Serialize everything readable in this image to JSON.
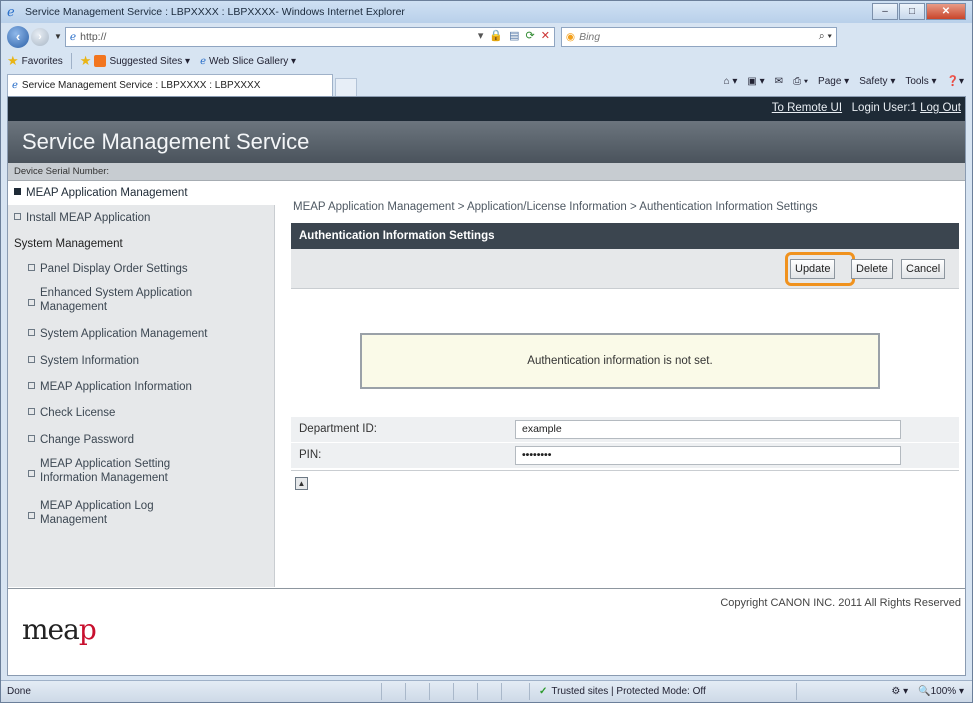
{
  "window": {
    "title": "Service Management Service : LBPXXXX : LBPXXXX- Windows Internet Explorer",
    "min": "–",
    "max": "□",
    "close": "✕"
  },
  "address": {
    "url": "http://",
    "search_placeholder": "Bing"
  },
  "favorites": {
    "favorites_label": "Favorites",
    "suggested_sites": "Suggested Sites ▾",
    "web_slice_gallery": "Web Slice Gallery ▾"
  },
  "tab": {
    "label": "Service Management Service : LBPXXXX : LBPXXXX"
  },
  "commandbar": {
    "page": "Page ▾",
    "safety": "Safety ▾",
    "tools": "Tools ▾",
    "help": "❓▾"
  },
  "header": {
    "remote_ui": "To Remote UI",
    "login_user": "Login User:1",
    "log_out": "Log Out",
    "app_title": "Service Management Service",
    "serial_label": "Device Serial Number:"
  },
  "sidebar": {
    "items": [
      {
        "label": "MEAP Application Management"
      },
      {
        "label": "Install MEAP Application"
      },
      {
        "label": "System Management"
      },
      {
        "label": "Panel Display Order Settings"
      },
      {
        "label_1": "Enhanced System Application",
        "label_2": "Management"
      },
      {
        "label": "System Application Management"
      },
      {
        "label": "System Information"
      },
      {
        "label": "MEAP Application Information"
      },
      {
        "label": "Check License"
      },
      {
        "label": "Change Password"
      },
      {
        "label_1": "MEAP Application Setting",
        "label_2": "Information Management"
      },
      {
        "label_1": "MEAP Application Log",
        "label_2": "Management"
      }
    ]
  },
  "main": {
    "breadcrumb": "MEAP Application Management > Application/License Information > Authentication Information Settings",
    "panel_title": "Authentication Information Settings",
    "buttons": {
      "update": "Update",
      "delete": "Delete",
      "cancel": "Cancel"
    },
    "message": "Authentication information is not set.",
    "form": {
      "department_label": "Department ID:",
      "department_value": "example",
      "pin_label": "PIN:",
      "pin_value": "••••••••"
    }
  },
  "footer": {
    "logo_text_1": "mea",
    "logo_text_2": "p",
    "copyright": "Copyright CANON INC. 2011 All Rights Reserved"
  },
  "status": {
    "done": "Done",
    "zone": "Trusted sites | Protected Mode: Off",
    "zoom": "100%"
  },
  "colors": {
    "highlight": "#f0921e",
    "header_dark": "#1e2a36",
    "panel_head": "#3b454f"
  }
}
